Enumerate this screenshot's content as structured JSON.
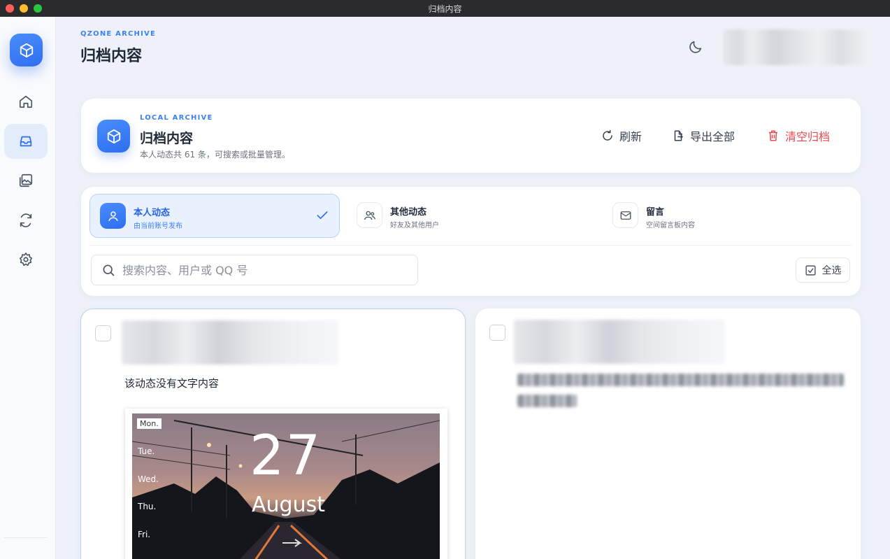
{
  "window": {
    "title": "归档内容"
  },
  "sidebar": {
    "logo_icon": "cube-icon",
    "items": [
      {
        "name": "home",
        "icon": "home-icon",
        "active": false
      },
      {
        "name": "archive",
        "icon": "inbox-icon",
        "active": true
      },
      {
        "name": "gallery",
        "icon": "image-icon",
        "active": false
      },
      {
        "name": "sync",
        "icon": "sync-icon",
        "active": false
      },
      {
        "name": "settings",
        "icon": "gear-icon",
        "active": false
      }
    ]
  },
  "header": {
    "eyebrow": "QZONE ARCHIVE",
    "title": "归档内容",
    "theme_icon": "moon-icon"
  },
  "archive_card": {
    "eyebrow": "LOCAL ARCHIVE",
    "title": "归档内容",
    "subtitle": "本人动态共 61 条，可搜索或批量管理。",
    "actions": {
      "refresh": "刷新",
      "export_all": "导出全部",
      "clear": "清空归档"
    }
  },
  "tabs": [
    {
      "label": "本人动态",
      "sub": "由当前账号发布",
      "active": true
    },
    {
      "label": "其他动态",
      "sub": "好友及其他用户",
      "active": false
    },
    {
      "label": "留言",
      "sub": "空间留言板内容",
      "active": false
    }
  ],
  "search": {
    "placeholder": "搜索内容、用户或 QQ 号",
    "value": ""
  },
  "select_all": "全选",
  "posts": [
    {
      "text": "该动态没有文字内容",
      "image": {
        "mon": "Mon.",
        "days": [
          "Tue.",
          "Wed.",
          "Thu.",
          "Fri."
        ],
        "date": "27",
        "month": "August"
      }
    }
  ],
  "colors": {
    "accent": "#2e6ef0",
    "danger": "#e5484d",
    "background": "#eef2f8"
  }
}
